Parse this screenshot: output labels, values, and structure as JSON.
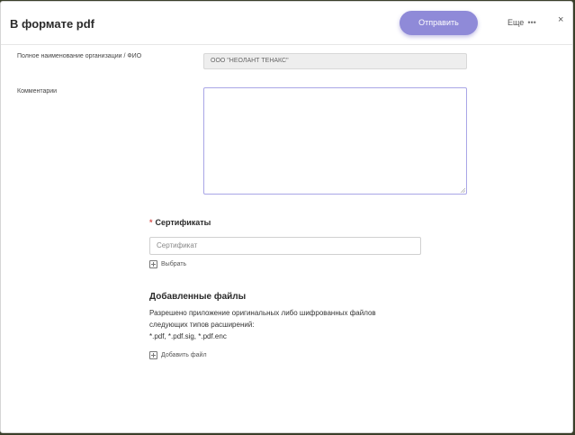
{
  "header": {
    "title": "В формате pdf",
    "send_label": "Отправить",
    "more_label": "Еще",
    "more_dots": "•••",
    "close_label": "×"
  },
  "form": {
    "org_label": "Полное наименование организации / ФИО",
    "org_value": "ООО \"НЕОЛАНТ ТЕНАКС\"",
    "comment_label": "Комментарии",
    "comment_value": ""
  },
  "certificates": {
    "required_mark": "*",
    "title": "Сертификаты",
    "placeholder": "Сертификат",
    "choose_label": "Выбрать"
  },
  "files": {
    "title": "Добавленные файлы",
    "desc_line1": "Разрешено приложение оригинальных либо шифрованных файлов",
    "desc_line2": "следующих типов расширений:",
    "desc_line3": "*.pdf, *.pdf.sig, *.pdf.enc",
    "add_label": "Добавить файл"
  },
  "colors": {
    "accent": "#8f8ad8",
    "focus_border": "#a9a6e6",
    "required": "#d9534f"
  }
}
